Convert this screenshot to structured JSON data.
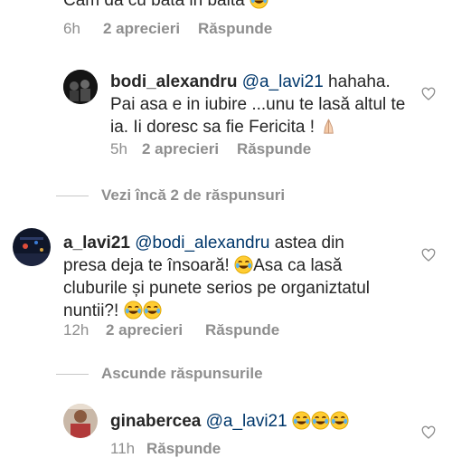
{
  "comment0": {
    "text_partial": "Cam da cu bata in balta",
    "time": "6h",
    "likes": "2 aprecieri",
    "reply": "Răspunde"
  },
  "comment1": {
    "username": "bodi_alexandru",
    "mention": "@a_lavi21",
    "text_line1": " hahaha.",
    "text_line2": "Pai asa e in iubire ...unu te lasă altul te",
    "text_line3": "ia. Ii doresc sa fie Fericita !",
    "time": "5h",
    "likes": "2 aprecieri",
    "reply": "Răspunde"
  },
  "view_more": "Vezi încă 2 de răspunsuri",
  "comment2": {
    "username": "a_lavi21",
    "mention": "@bodi_alexandru",
    "text_line1": "  astea din",
    "text_line2a": "presa deja te însoară!",
    "text_line2b": "Asa ca lasă",
    "text_line3": "cluburile și punete serios pe organiztatul",
    "text_line4": "nuntii?!",
    "time": "12h",
    "likes": "2 aprecieri",
    "reply": "Răspunde"
  },
  "hide_replies": "Ascunde răspunsurile",
  "comment3": {
    "username": "ginabercea",
    "mention": "@a_lavi21",
    "time": "11h",
    "reply": "Răspunde"
  },
  "icons": {
    "like": "heart-outline-icon",
    "laugh": "tears-of-joy-emoji",
    "pray": "folded-hands-emoji"
  },
  "colors": {
    "text": "#262626",
    "meta": "#8e8e8e",
    "mention": "#00376b",
    "divider": "#c7c7c7"
  }
}
